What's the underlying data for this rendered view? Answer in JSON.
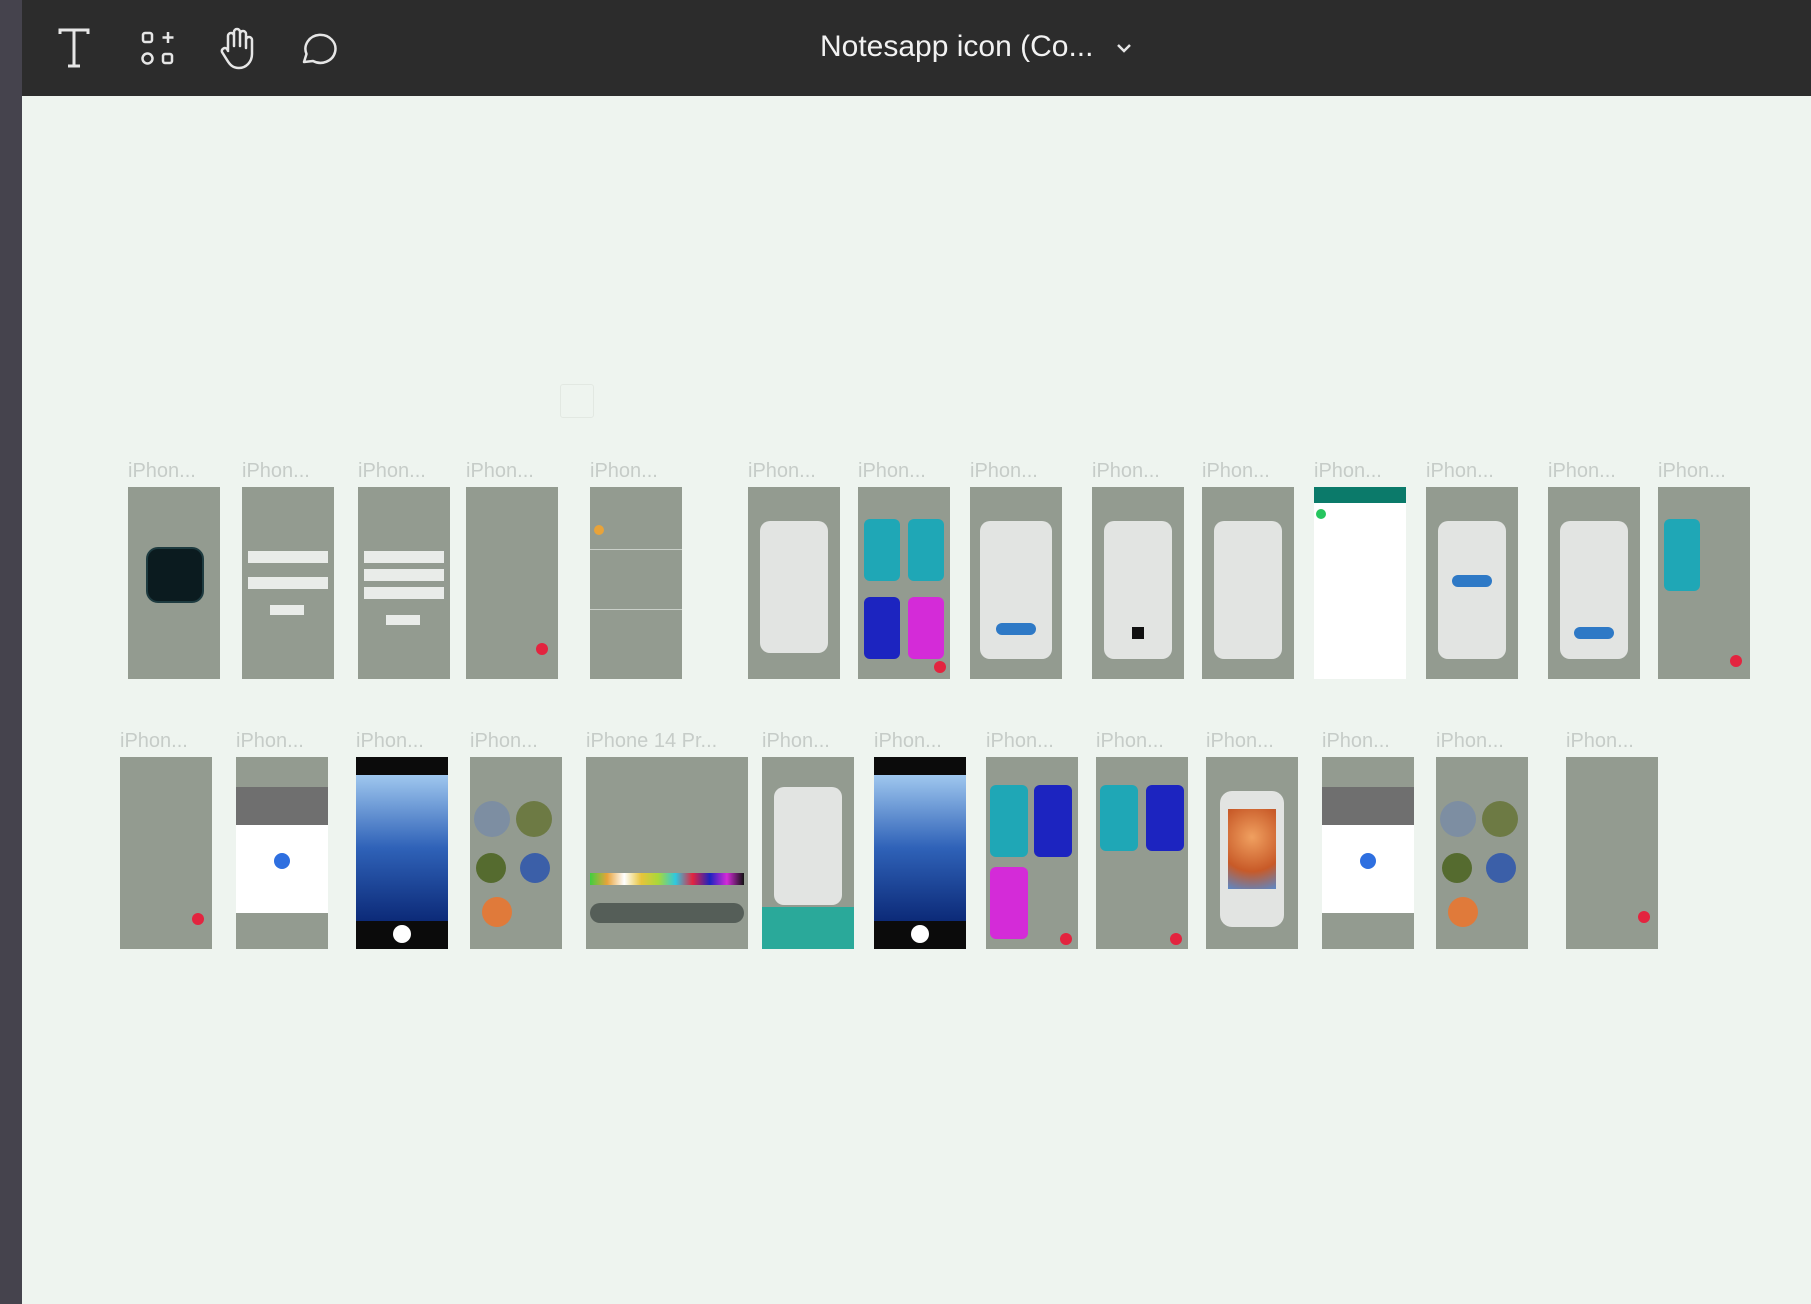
{
  "toolbar": {
    "tools": [
      {
        "name": "text-tool",
        "icon": "text-icon"
      },
      {
        "name": "components-tool",
        "icon": "components-icon"
      },
      {
        "name": "hand-tool",
        "icon": "hand-icon"
      },
      {
        "name": "comment-tool",
        "icon": "comment-icon"
      }
    ],
    "file_title": "Notesapp icon (Co...",
    "title_menu_icon": "chevron-down-icon"
  },
  "canvas": {
    "background": "#eef4ef",
    "frame_fill": "#939b90",
    "accent_colors": [
      "#1fa7b6",
      "#1c24c0",
      "#d42bd8",
      "#e3243f",
      "#2e79c6"
    ],
    "row1_labels": [
      "iPhon...",
      "iPhon...",
      "iPhon...",
      "iPhon...",
      "iPhon...",
      "iPhon...",
      "iPhon...",
      "iPhon...",
      "iPhon...",
      "iPhon...",
      "iPhon...",
      "iPhon...",
      "iPhon...",
      "iPhon..."
    ],
    "row2_labels": [
      "iPhon...",
      "iPhon...",
      "iPhon...",
      "iPhon...",
      "iPhone 14 Pr...",
      "iPhon...",
      "iPhon...",
      "iPhon...",
      "iPhon...",
      "iPhon...",
      "iPhon...",
      "iPhon...",
      "iPhon..."
    ]
  }
}
